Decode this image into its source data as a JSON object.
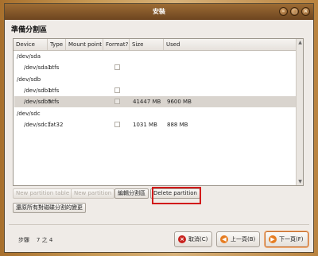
{
  "window": {
    "title": "安裝"
  },
  "page": {
    "heading": "準備分割區"
  },
  "table": {
    "columns": [
      "Device",
      "Type",
      "Mount point",
      "Format?",
      "Size",
      "Used"
    ],
    "rows": [
      {
        "device": "/dev/sda",
        "type": "",
        "size": "",
        "used": "",
        "kind": "disk"
      },
      {
        "device": "/dev/sda1",
        "type": "ntfs",
        "size": "",
        "used": "",
        "kind": "part"
      },
      {
        "device": "/dev/sdb",
        "type": "",
        "size": "",
        "used": "",
        "kind": "disk"
      },
      {
        "device": "/dev/sdb1",
        "type": "ntfs",
        "size": "",
        "used": "",
        "kind": "part"
      },
      {
        "device": "/dev/sdb5",
        "type": "ntfs",
        "size": "41447 MB",
        "used": "9600 MB",
        "kind": "part",
        "selected": true
      },
      {
        "device": "/dev/sdc",
        "type": "",
        "size": "",
        "used": "",
        "kind": "disk"
      },
      {
        "device": "/dev/sdc1",
        "type": "fat32",
        "size": "1031 MB",
        "used": "888 MB",
        "kind": "part"
      }
    ]
  },
  "actions": {
    "new_table": "New partition table",
    "new_partition": "New partition",
    "edit_partition": "編輯分割區",
    "delete_partition": "Delete partition",
    "undo_all": "還原所有對磁碟分割的變更"
  },
  "footer": {
    "step_label": "步驟",
    "step_current": "7",
    "step_sep": "之",
    "step_total": "4",
    "cancel": "取消(C)",
    "back": "上一頁(B)",
    "forward": "下一頁(F)"
  },
  "colors": {
    "accent": "#d21a1a",
    "selected_row": "#d9d4ce",
    "title_bar": "#7d5126"
  }
}
